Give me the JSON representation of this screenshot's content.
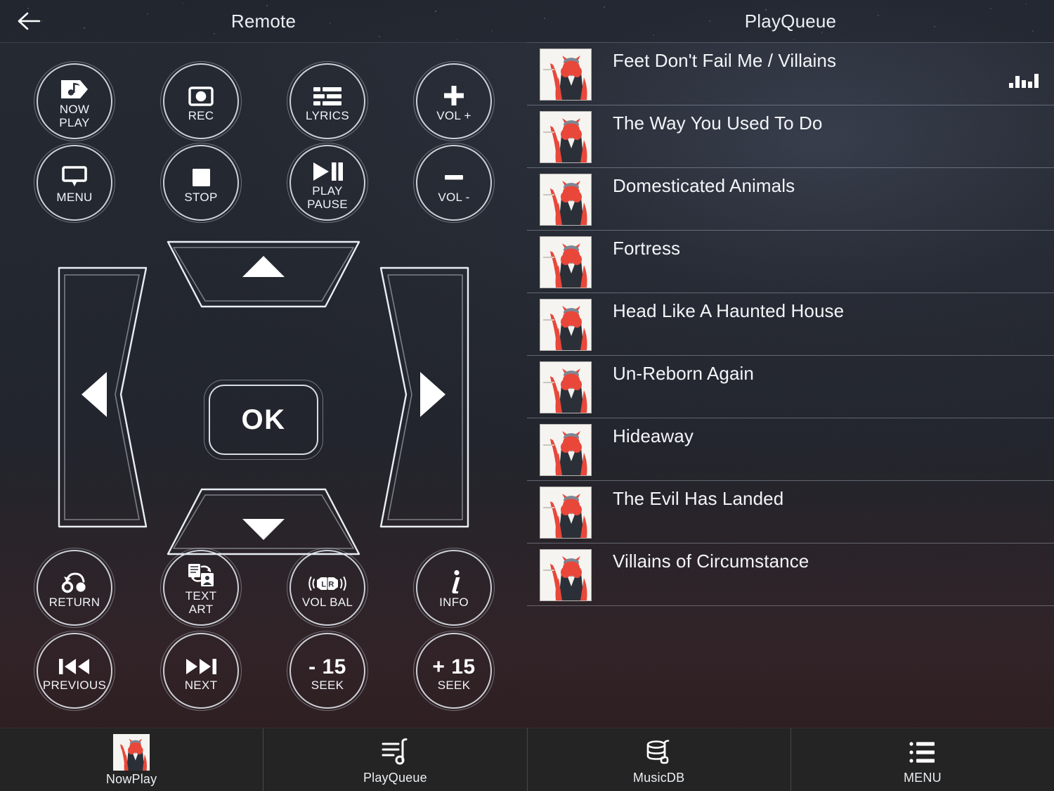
{
  "header": {
    "back_icon": "arrow-left-icon",
    "remote_title": "Remote",
    "queue_title": "PlayQueue"
  },
  "remote": {
    "buttons": [
      {
        "id": "now-play",
        "icon": "music-note-flag-icon",
        "label": "NOW\nPLAY"
      },
      {
        "id": "rec",
        "icon": "record-icon",
        "label": "REC"
      },
      {
        "id": "lyrics",
        "icon": "lyrics-lines-icon",
        "label": "LYRICS"
      },
      {
        "id": "vol-up",
        "icon": "plus-icon",
        "label": "VOL +"
      },
      {
        "id": "menu",
        "icon": "speech-bubble-icon",
        "label": "MENU"
      },
      {
        "id": "stop",
        "icon": "stop-square-icon",
        "label": "STOP"
      },
      {
        "id": "play-pause",
        "icon": "play-pause-icon",
        "label": "PLAY\nPAUSE"
      },
      {
        "id": "vol-down",
        "icon": "minus-icon",
        "label": "VOL -"
      },
      {
        "id": "return",
        "icon": "return-loop-icon",
        "label": "RETURN"
      },
      {
        "id": "text-art",
        "icon": "text-art-swap-icon",
        "label": "TEXT\nART"
      },
      {
        "id": "vol-bal",
        "icon": "left-right-balance-icon",
        "label": "VOL BAL"
      },
      {
        "id": "info",
        "icon": "info-italic-i-icon",
        "label": "INFO"
      },
      {
        "id": "previous",
        "icon": "skip-previous-icon",
        "label": "PREVIOUS"
      },
      {
        "id": "next",
        "icon": "skip-next-icon",
        "label": "NEXT"
      },
      {
        "id": "seek-back",
        "icon": "minus-15-text",
        "label": "SEEK",
        "big_text": "- 15"
      },
      {
        "id": "seek-fwd",
        "icon": "plus-15-text",
        "label": "SEEK",
        "big_text": "+ 15"
      }
    ],
    "dpad": {
      "up_icon": "triangle-up-icon",
      "down_icon": "triangle-down-icon",
      "left_icon": "triangle-left-icon",
      "right_icon": "triangle-right-icon",
      "ok_label": "OK"
    }
  },
  "playqueue": {
    "now_playing_indicator": "equalizer-bars-icon",
    "now_playing_index": 0,
    "tracks": [
      {
        "title": "Feet Don't Fail Me / Villains",
        "artwork": "villains-album-art"
      },
      {
        "title": "The Way You Used To Do",
        "artwork": "villains-album-art"
      },
      {
        "title": "Domesticated Animals",
        "artwork": "villains-album-art"
      },
      {
        "title": "Fortress",
        "artwork": "villains-album-art"
      },
      {
        "title": "Head Like A Haunted House",
        "artwork": "villains-album-art"
      },
      {
        "title": "Un-Reborn Again",
        "artwork": "villains-album-art"
      },
      {
        "title": "Hideaway",
        "artwork": "villains-album-art"
      },
      {
        "title": "The Evil Has Landed",
        "artwork": "villains-album-art"
      },
      {
        "title": "Villains of Circumstance",
        "artwork": "villains-album-art"
      }
    ]
  },
  "bottom_nav": {
    "items": [
      {
        "id": "nowplay",
        "icon": "album-art-icon",
        "label": "NowPlay"
      },
      {
        "id": "playqueue",
        "icon": "queue-list-icon",
        "label": "PlayQueue"
      },
      {
        "id": "musicdb",
        "icon": "database-icon",
        "label": "MusicDB"
      },
      {
        "id": "menu",
        "icon": "hamburger-list-icon",
        "label": "MENU"
      }
    ]
  },
  "colors": {
    "background_top": "#2a2f3a",
    "background_bottom": "#3a2426",
    "header_text": "#eceff3",
    "outline": "#e4e9f0",
    "nav_bar": "#242424",
    "album_red": "#e03c2e"
  }
}
